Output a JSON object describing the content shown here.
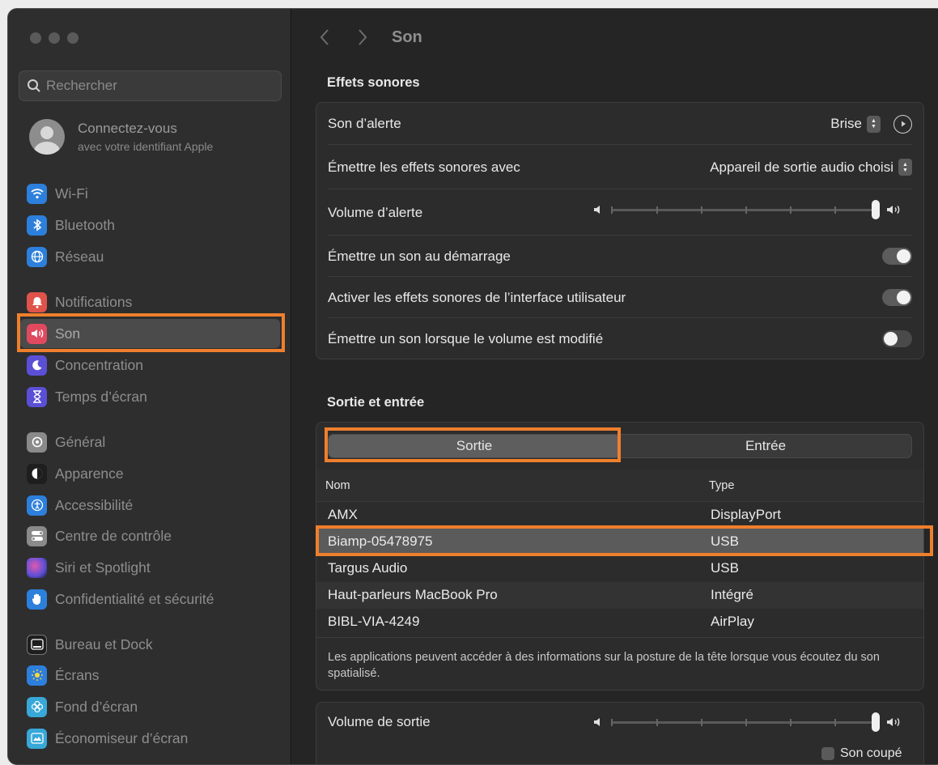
{
  "sidebar": {
    "search_placeholder": "Rechercher",
    "account": {
      "title": "Connectez-vous",
      "subtitle": "avec votre identifiant Apple"
    },
    "items": [
      {
        "label": "Wi-Fi",
        "icon": "wifi-icon",
        "color": "#2d7fdc"
      },
      {
        "label": "Bluetooth",
        "icon": "bluetooth-icon",
        "color": "#2d7fdc"
      },
      {
        "label": "Réseau",
        "icon": "globe-icon",
        "color": "#2d7fdc"
      },
      {
        "label": "Notifications",
        "icon": "bell-icon",
        "color": "#e0534a"
      },
      {
        "label": "Son",
        "icon": "speaker-icon",
        "color": "#e04a5e"
      },
      {
        "label": "Concentration",
        "icon": "moon-icon",
        "color": "#5b4fd6"
      },
      {
        "label": "Temps d’écran",
        "icon": "hourglass-icon",
        "color": "#5b4fd6"
      },
      {
        "label": "Général",
        "icon": "gear-icon",
        "color": "#8a8a8a"
      },
      {
        "label": "Apparence",
        "icon": "appearance-icon",
        "color": "#1e1e1e"
      },
      {
        "label": "Accessibilité",
        "icon": "accessibility-icon",
        "color": "#2d7fdc"
      },
      {
        "label": "Centre de contrôle",
        "icon": "control-center-icon",
        "color": "#8a8a8a"
      },
      {
        "label": "Siri et Spotlight",
        "icon": "siri-icon",
        "color": "#7a4fd0"
      },
      {
        "label": "Confidentialité et sécurité",
        "icon": "hand-icon",
        "color": "#2d7fdc"
      },
      {
        "label": "Bureau et Dock",
        "icon": "dock-icon",
        "color": "#1e1e1e"
      },
      {
        "label": "Écrans",
        "icon": "display-icon",
        "color": "#2d7fdc"
      },
      {
        "label": "Fond d’écran",
        "icon": "wallpaper-icon",
        "color": "#38a8d8"
      },
      {
        "label": "Économiseur d’écran",
        "icon": "screensaver-icon",
        "color": "#38a8d8"
      }
    ]
  },
  "main": {
    "title": "Son",
    "sound_effects": {
      "heading": "Effets sonores",
      "alert_sound_label": "Son d’alerte",
      "alert_sound_value": "Brise",
      "play_with_label": "Émettre les effets sonores avec",
      "play_with_value": "Appareil de sortie audio choisi",
      "alert_volume_label": "Volume d’alerte",
      "alert_volume_level": 1.0,
      "startup_label": "Émettre un son au démarrage",
      "startup_on": true,
      "ui_sounds_label": "Activer les effets sonores de l’interface utilisateur",
      "ui_sounds_on": true,
      "volume_feedback_label": "Émettre un son lorsque le volume est modifié",
      "volume_feedback_on": false
    },
    "output_input": {
      "heading": "Sortie et entrée",
      "tab_output": "Sortie",
      "tab_input": "Entrée",
      "col_name": "Nom",
      "col_type": "Type",
      "devices": [
        {
          "name": "AMX",
          "type": "DisplayPort"
        },
        {
          "name": "Biamp-05478975",
          "type": "USB"
        },
        {
          "name": "Targus Audio",
          "type": "USB"
        },
        {
          "name": "Haut-parleurs MacBook Pro",
          "type": "Intégré"
        },
        {
          "name": "BIBL-VIA-4249",
          "type": "AirPlay"
        }
      ],
      "note": "Les applications peuvent accéder à des informations sur la posture de la tête lorsque vous écoutez du son spatialisé."
    },
    "output_volume": {
      "label": "Volume de sortie",
      "level": 1.0,
      "mute_label": "Son coupé"
    }
  },
  "colors": {
    "highlight": "#ef7f2c"
  }
}
